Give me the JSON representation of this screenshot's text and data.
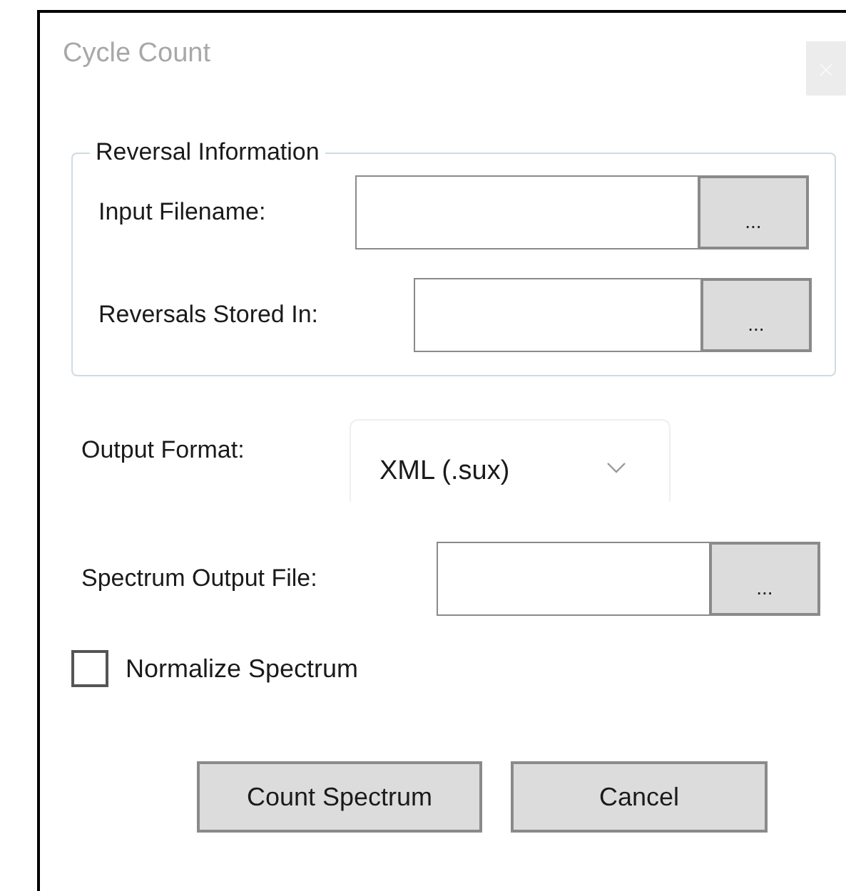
{
  "window": {
    "title": "Cycle Count"
  },
  "reversal_group": {
    "legend": "Reversal Information",
    "rows": [
      {
        "label": "Input Filename:",
        "browse": "..."
      },
      {
        "label": "Reversals Stored In:",
        "browse": "..."
      }
    ]
  },
  "output_format": {
    "label": "Output Format:",
    "value": "XML (.sux)"
  },
  "spectrum_output": {
    "label": "Spectrum Output File:",
    "browse": "..."
  },
  "normalize": {
    "label": "Normalize Spectrum",
    "checked": false
  },
  "buttons": [
    "Count Spectrum",
    "Cancel"
  ]
}
